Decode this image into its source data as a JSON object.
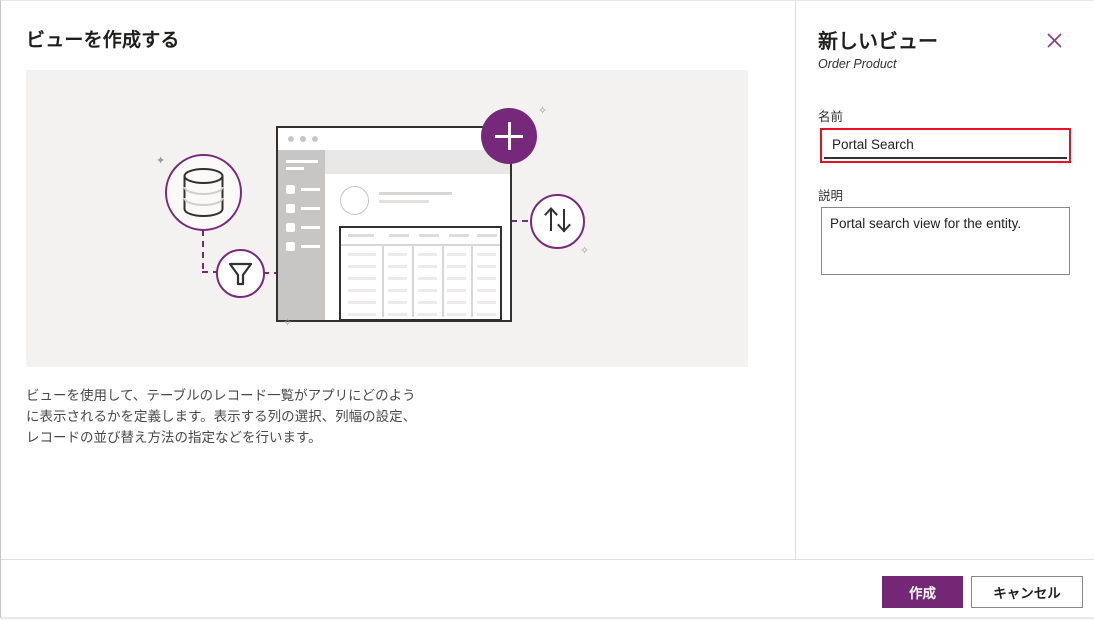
{
  "left": {
    "title": "ビューを作成する",
    "description_lines": [
      "ビューを使用して、テーブルのレコード一覧がアプリにどのよう",
      "に表示されるかを定義します。表示する列の選択、列幅の設定、",
      "レコードの並び替え方法の指定などを行います。"
    ],
    "illustration": {
      "icons": [
        "database-icon",
        "filter-icon",
        "sort-icon",
        "plus-icon",
        "browser-window-mockup"
      ],
      "accent_color": "#7a2a7d",
      "background_color": "#f3f2f1"
    }
  },
  "panel": {
    "title": "新しいビュー",
    "subtitle": "Order Product",
    "close_icon": "close-icon",
    "name_label": "名前",
    "name_value": "Portal Search",
    "name_placeholder": "",
    "description_label": "説明",
    "description_value": "Portal search view for the entity.",
    "description_placeholder": "",
    "highlight_color": "#e81123"
  },
  "footer": {
    "create_label": "作成",
    "cancel_label": "キャンセル",
    "primary_color": "#742774"
  }
}
